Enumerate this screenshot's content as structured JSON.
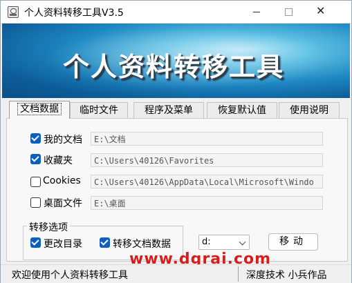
{
  "window": {
    "title": "个人资料转移工具V3.5"
  },
  "banner": {
    "title": "个人资料转移工具"
  },
  "tabs": [
    {
      "label": "文档数据"
    },
    {
      "label": "临时文件"
    },
    {
      "label": "程序及菜单"
    },
    {
      "label": "恢复默认值"
    },
    {
      "label": "使用说明"
    }
  ],
  "items": [
    {
      "label": "我的文档",
      "checked": true,
      "path": "E:\\文档"
    },
    {
      "label": "收藏夹",
      "checked": true,
      "path": "C:\\Users\\40126\\Favorites"
    },
    {
      "label": "Cookies",
      "checked": false,
      "path": "C:\\Users\\40126\\AppData\\Local\\Microsoft\\Windo"
    },
    {
      "label": "桌面文件",
      "checked": false,
      "path": "E:\\桌面"
    }
  ],
  "transfer_options": {
    "legend": "转移选项",
    "change_dir": {
      "label": "更改目录",
      "checked": true
    },
    "move_docs": {
      "label": "转移文档数据",
      "checked": true
    }
  },
  "drive_select": {
    "value": "d:"
  },
  "move_button": {
    "label": "移动"
  },
  "status": {
    "left": "欢迎使用个人资料转移工具",
    "right": "深度技术 小兵作品"
  },
  "watermark": "www.dgrai.com",
  "colors": {
    "accent": "#0d5fbf",
    "banner": "#1e88c2",
    "watermark": "#d91c1c"
  }
}
